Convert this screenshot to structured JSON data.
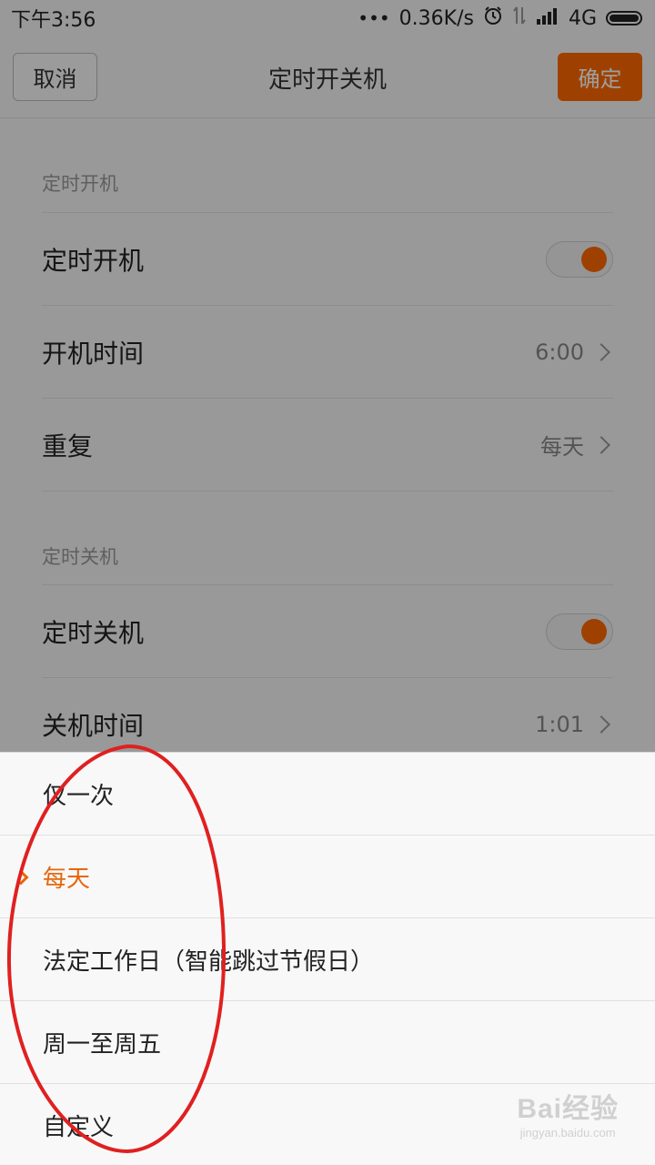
{
  "status_bar": {
    "time": "下午3:56",
    "network_speed": "0.36K/s",
    "network_type": "4G",
    "icons": [
      "more-dots-icon",
      "alarm-icon",
      "data-arrows-icon",
      "signal-icon",
      "battery-icon"
    ]
  },
  "title_bar": {
    "cancel_label": "取消",
    "title": "定时开关机",
    "confirm_label": "确定"
  },
  "settings": {
    "power_on_section": {
      "header": "定时开机",
      "toggle_label": "定时开机",
      "toggle_on": true,
      "time_label": "开机时间",
      "time_value": "6:00",
      "repeat_label": "重复",
      "repeat_value": "每天"
    },
    "power_off_section": {
      "header": "定时关机",
      "toggle_label": "定时关机",
      "toggle_on": true,
      "time_label": "关机时间",
      "time_value": "1:01"
    }
  },
  "repeat_sheet": {
    "selected_index": 1,
    "options": [
      {
        "label": "仅一次"
      },
      {
        "label": "每天"
      },
      {
        "label": "法定工作日（智能跳过节假日）"
      },
      {
        "label": "周一至周五"
      },
      {
        "label": "自定义"
      }
    ]
  },
  "colors": {
    "accent": "#ff6a00",
    "selected_text": "#e8660a",
    "annotation": "#e02020"
  },
  "watermark": {
    "main": "Bai经验",
    "sub": "jingyan.baidu.com"
  }
}
